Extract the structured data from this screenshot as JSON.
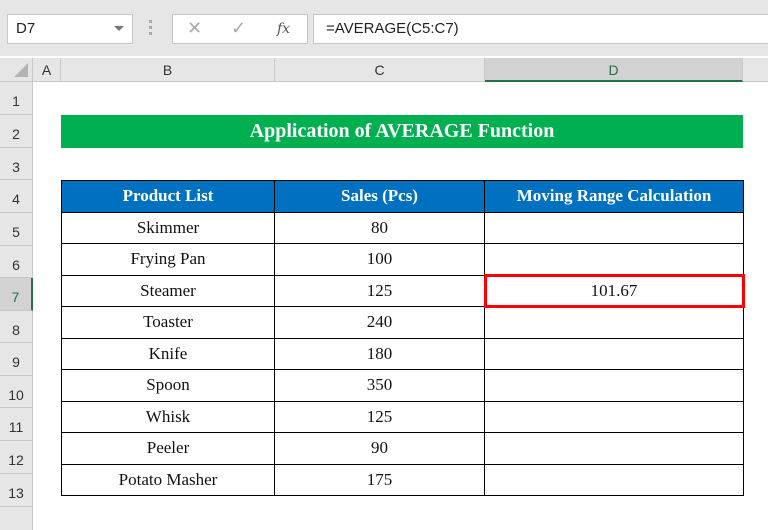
{
  "formula_bar": {
    "name_box": "D7",
    "cancel_icon": "✕",
    "enter_icon": "✓",
    "function_icon": "fx",
    "formula": "=AVERAGE(C5:C7)"
  },
  "columns": [
    "A",
    "B",
    "C",
    "D"
  ],
  "selected_column": "D",
  "rows": [
    "1",
    "2",
    "3",
    "4",
    "5",
    "6",
    "7",
    "8",
    "9",
    "10",
    "11",
    "12",
    "13"
  ],
  "selected_row": "7",
  "sheet": {
    "title": "Application of AVERAGE Function",
    "headers": [
      "Product List",
      "Sales (Pcs)",
      "Moving Range Calculation"
    ],
    "records": [
      {
        "product": "Skimmer",
        "sales": "80",
        "moving_range": ""
      },
      {
        "product": "Frying Pan",
        "sales": "100",
        "moving_range": ""
      },
      {
        "product": "Steamer",
        "sales": "125",
        "moving_range": "101.67"
      },
      {
        "product": "Toaster",
        "sales": "240",
        "moving_range": ""
      },
      {
        "product": "Knife",
        "sales": "180",
        "moving_range": ""
      },
      {
        "product": "Spoon",
        "sales": "350",
        "moving_range": ""
      },
      {
        "product": "Whisk",
        "sales": "125",
        "moving_range": ""
      },
      {
        "product": "Peeler",
        "sales": "90",
        "moving_range": ""
      },
      {
        "product": "Potato Masher",
        "sales": "175",
        "moving_range": ""
      }
    ]
  },
  "colors": {
    "title_fill": "#00b050",
    "header_fill": "#0070c0",
    "active_cell_border": "#ff0000",
    "selection_accent": "#217346"
  }
}
